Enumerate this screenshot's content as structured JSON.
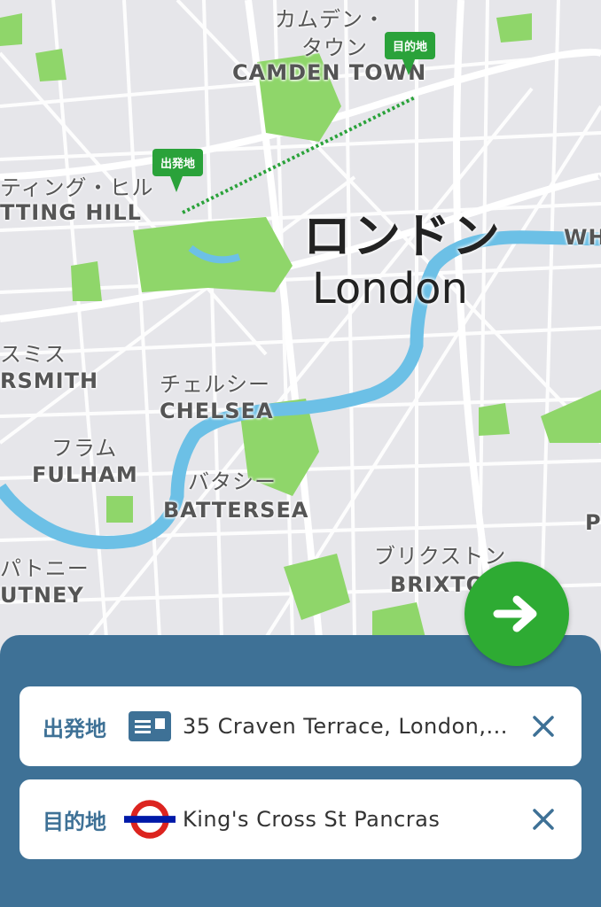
{
  "map": {
    "city_label_jp": "ロンドン",
    "city_label_en": "London",
    "districts": [
      {
        "jp": "カムデン・",
        "jp2": "タウン",
        "en": "CAMDEN TOWN"
      },
      {
        "jp": "ティング・ヒル",
        "en": "TTING HILL"
      },
      {
        "jp": "スミス",
        "en": "RSMITH"
      },
      {
        "jp": "チェルシー",
        "en": "CHELSEA"
      },
      {
        "jp": "フラム",
        "en": "FULHAM"
      },
      {
        "jp": "バタシー",
        "en": "BATTERSEA"
      },
      {
        "jp": "パトニー",
        "en": "UTNEY"
      },
      {
        "jp": "ブリクストン",
        "en": "BRIXTON"
      },
      {
        "en": "WH"
      },
      {
        "en": "P"
      }
    ],
    "origin_pin": "出発地",
    "destination_pin": "目的地",
    "colors": {
      "park": "#8fd66a",
      "river": "#6cc0e6",
      "road": "#ffffff",
      "pin": "#2aa23a",
      "land": "#e6e6ea"
    }
  },
  "go_button": {
    "icon": "arrow-right-icon",
    "color": "#2eab33"
  },
  "panel": {
    "color": "#3e7196",
    "origin": {
      "label": "出発地",
      "icon": "address-card-icon",
      "value": "35 Craven Terrace, London,..."
    },
    "destination": {
      "label": "目的地",
      "icon": "underground-roundel-icon",
      "value": "King's Cross St Pancras"
    }
  }
}
